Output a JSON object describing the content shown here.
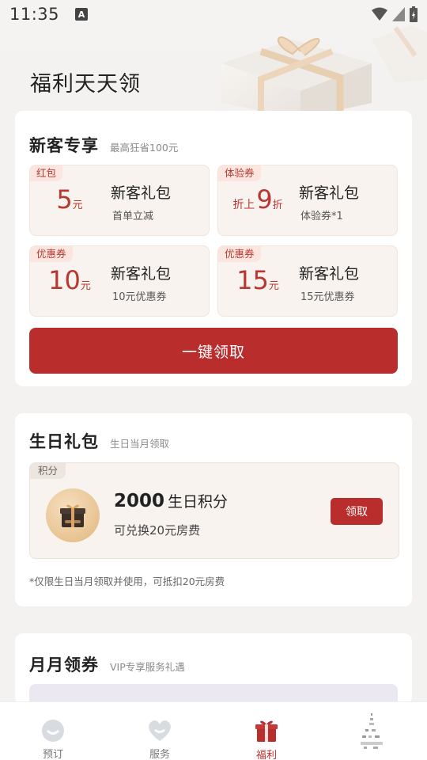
{
  "status_bar": {
    "time": "11:35",
    "notif": "A"
  },
  "page": {
    "title": "福利天天领"
  },
  "new_customer": {
    "title": "新客专享",
    "subtitle": "最高狂省100元",
    "coupons": [
      {
        "tag": "红包",
        "prefix": "",
        "value": "5",
        "unit": "元",
        "name": "新客礼包",
        "desc": "首单立减"
      },
      {
        "tag": "体验券",
        "prefix": "折上",
        "value": "9",
        "unit": "折",
        "name": "新客礼包",
        "desc": "体验券*1"
      },
      {
        "tag": "优惠券",
        "prefix": "",
        "value": "10",
        "unit": "元",
        "name": "新客礼包",
        "desc": "10元优惠券"
      },
      {
        "tag": "优惠券",
        "prefix": "",
        "value": "15",
        "unit": "元",
        "name": "新客礼包",
        "desc": "15元优惠券"
      }
    ],
    "claim_all_label": "一键领取"
  },
  "birthday": {
    "title": "生日礼包",
    "subtitle": "生日当月领取",
    "tag": "积分",
    "points": "2000",
    "points_unit": "生日积分",
    "desc": "可兑换20元房费",
    "button": "领取",
    "note": "*仅限生日当月领取并使用，可抵扣20元房费"
  },
  "monthly": {
    "title": "月月领券",
    "subtitle": "VIP专享服务礼遇"
  },
  "tabbar": {
    "items": [
      {
        "label": "预订",
        "icon": "home-icon"
      },
      {
        "label": "服务",
        "icon": "heart-icon"
      },
      {
        "label": "福利",
        "icon": "gift-icon",
        "active": true
      }
    ]
  },
  "colors": {
    "accent": "#b92d2d",
    "tag_bg": "#fbe5de",
    "coupon_bg": "#f8f3ef",
    "page_bg": "#f4f2f1"
  }
}
